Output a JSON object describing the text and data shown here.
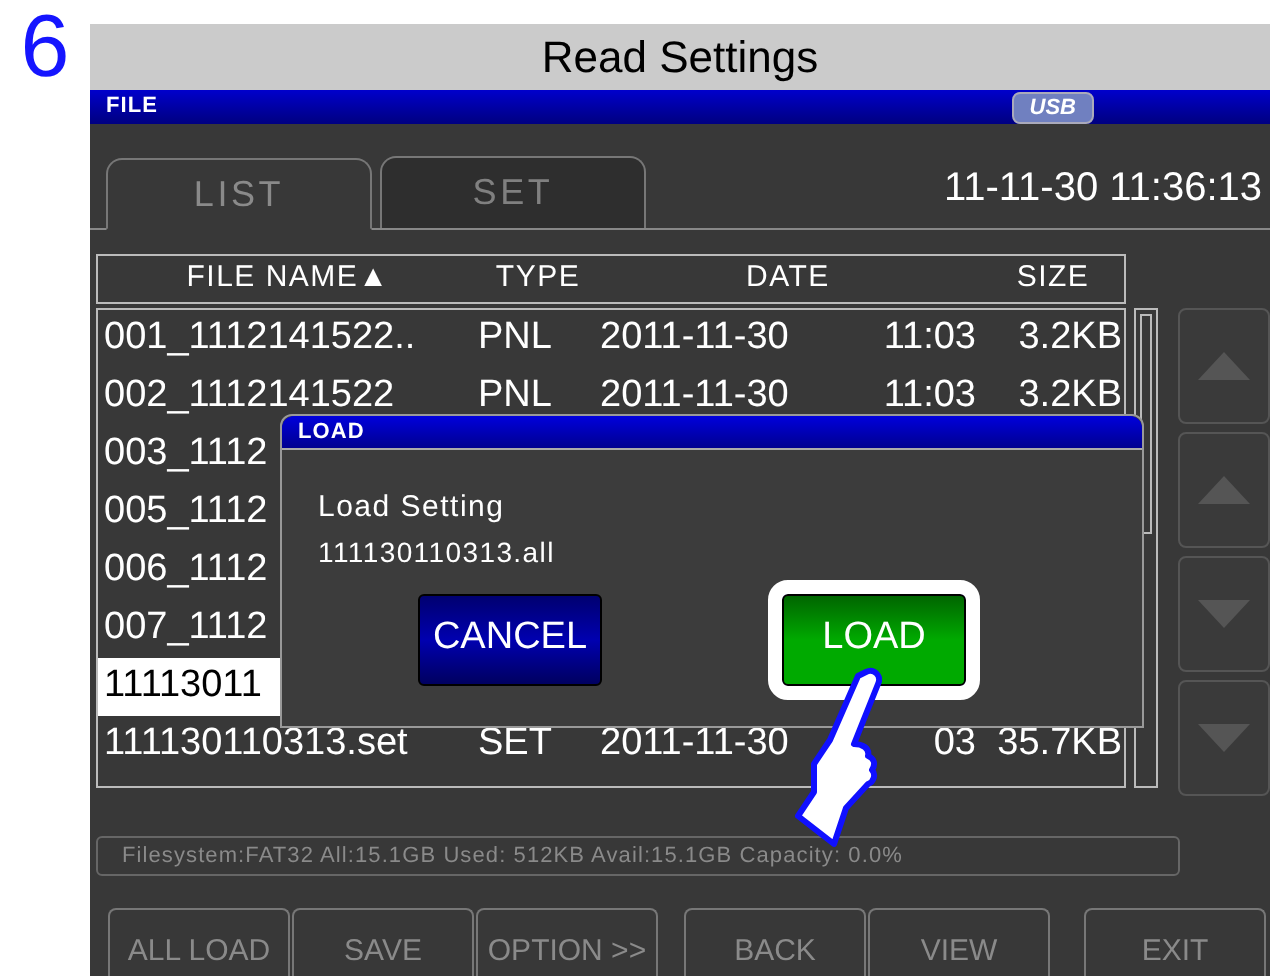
{
  "step": "6",
  "title": "Read Settings",
  "header": {
    "label": "FILE",
    "usb": "USB"
  },
  "tabs": [
    {
      "label": "LIST",
      "selected": true
    },
    {
      "label": "SET",
      "selected": false
    }
  ],
  "clock": "11-11-30 11:36:13",
  "table": {
    "columns": [
      "FILE NAME▲",
      "TYPE",
      "DATE",
      "SIZE"
    ],
    "rows": [
      {
        "name": "001_1112141522..",
        "type": "PNL",
        "date": "2011-11-30",
        "time": "11:03",
        "size": "3.2KB",
        "selected": false
      },
      {
        "name": "002_1112141522",
        "type": "PNL",
        "date": "2011-11-30",
        "time": "11:03",
        "size": "3.2KB",
        "selected": false
      },
      {
        "name": "003_1112",
        "selected": false
      },
      {
        "name": "005_1112",
        "selected": false
      },
      {
        "name": "006_1112",
        "selected": false
      },
      {
        "name": "007_1112",
        "selected": false
      },
      {
        "name": "11113011",
        "selected": true
      },
      {
        "name": "111130110313.set",
        "type": "SET",
        "date": "2011-11-30",
        "time": "03",
        "size": "35.7KB",
        "selected": false
      }
    ]
  },
  "dialog": {
    "title": "LOAD",
    "message": "Load Setting",
    "file": "111130110313.all",
    "buttons": [
      {
        "label": "CANCEL",
        "kind": "cancel",
        "selected": false
      },
      {
        "label": "LOAD",
        "kind": "confirm",
        "selected": true
      }
    ]
  },
  "status": "Filesystem:FAT32 All:15.1GB Used: 512KB Avail:15.1GB Capacity: 0.0%",
  "buttons": [
    "ALL LOAD",
    "SAVE",
    "OPTION >>",
    "BACK",
    "VIEW",
    "EXIT"
  ]
}
